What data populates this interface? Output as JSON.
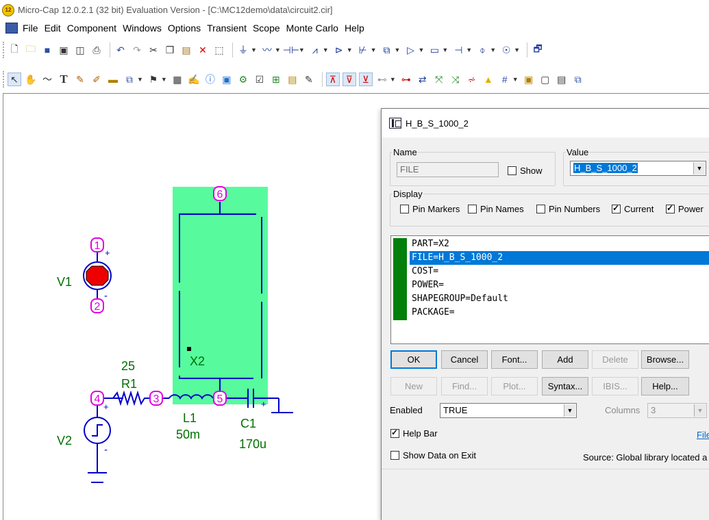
{
  "window": {
    "app_icon_text": "12",
    "title": "Micro-Cap 12.0.2.1 (32 bit) Evaluation Version - [C:\\MC12demo\\data\\circuit2.cir]"
  },
  "menu": [
    "File",
    "Edit",
    "Component",
    "Windows",
    "Options",
    "Transient",
    "Scope",
    "Monte Carlo",
    "Help"
  ],
  "toolbar1_icons": [
    "new-file-icon",
    "open-file-icon",
    "save-icon",
    "close-file-icon",
    "print-preview-icon",
    "print-icon",
    "undo-icon",
    "redo-icon",
    "cut-icon",
    "copy-icon",
    "paste-icon",
    "delete-icon",
    "select-all-icon",
    "ground-icon",
    "wire-icon",
    "capacitor-icon",
    "resistor-icon",
    "diode-icon",
    "transistor-icon",
    "subckt-icon",
    "opamp-icon",
    "macro-icon",
    "battery-icon",
    "current-source-icon",
    "voltage-source-icon",
    "window-icon"
  ],
  "toolbar2_icons": [
    "select-mode-icon",
    "pan-icon",
    "wire-mode-icon",
    "text-mode-icon",
    "line-mode-icon",
    "pen-mode-icon",
    "bus-icon",
    "component-icon",
    "flag-icon",
    "table-icon",
    "edit-icon",
    "info-icon",
    "help-icon",
    "check-icon",
    "attribute-text-icon",
    "grid-icon",
    "edit-text-icon",
    "pin-names-icon",
    "pin-numbers-icon",
    "node-numbers-icon",
    "node-voltages-icon",
    "currents-icon",
    "powers-icon",
    "warning-icon",
    "grid-toggle-icon",
    "page-icon",
    "sheet-icon",
    "text-page-icon"
  ],
  "schematic": {
    "labels": {
      "v1": "V1",
      "v2": "V2",
      "x2": "X2",
      "r1_value": "25",
      "r1_name": "R1",
      "l1_name": "L1",
      "l1_value": "50m",
      "c1_name": "C1",
      "c1_value": "170u",
      "plus": "+",
      "minus": "-"
    },
    "nodes": [
      "1",
      "2",
      "3",
      "4",
      "5",
      "6"
    ]
  },
  "dialog": {
    "title": "H_B_S_1000_2",
    "name_legend": "Name",
    "name_value": "FILE",
    "show_label": "Show",
    "show_checked": false,
    "value_legend": "Value",
    "value_value": "H_B_S_1000_2",
    "display_legend": "Display",
    "display_options": [
      {
        "label": "Pin Markers",
        "checked": false
      },
      {
        "label": "Pin Names",
        "checked": false
      },
      {
        "label": "Pin Numbers",
        "checked": false
      },
      {
        "label": "Current",
        "checked": true
      },
      {
        "label": "Power",
        "checked": true
      }
    ],
    "attributes": [
      "PART=X2",
      "FILE=H_B_S_1000_2",
      "COST=",
      "POWER=",
      "SHAPEGROUP=Default",
      "PACKAGE="
    ],
    "selected_attribute_index": 1,
    "buttons_row1": [
      {
        "label": "OK",
        "enabled": true
      },
      {
        "label": "Cancel",
        "enabled": true
      },
      {
        "label": "Font...",
        "enabled": true
      },
      {
        "label": "Add",
        "enabled": true
      },
      {
        "label": "Delete",
        "enabled": false
      },
      {
        "label": "Browse...",
        "enabled": true
      }
    ],
    "buttons_row2": [
      {
        "label": "New",
        "enabled": false
      },
      {
        "label": "Find...",
        "enabled": false
      },
      {
        "label": "Plot...",
        "enabled": false
      },
      {
        "label": "Syntax...",
        "enabled": true
      },
      {
        "label": "IBIS...",
        "enabled": false
      },
      {
        "label": "Help...",
        "enabled": true
      }
    ],
    "enabled_label": "Enabled",
    "enabled_value": "TRUE",
    "columns_label": "Columns",
    "columns_value": "3",
    "help_bar_label": "Help Bar",
    "help_bar_checked": true,
    "file_link": "File",
    "show_data_label": "Show Data on Exit",
    "show_data_checked": false,
    "source_text": "Source: Global library located a"
  },
  "colors": {
    "wire": "#0000c8",
    "pin": "#e000e0",
    "label_green": "#007000",
    "subckt_fill": "#57fb9d",
    "source_red": "#ee0000",
    "select_blue": "#0078d7",
    "attr_green": "#037f0b"
  }
}
